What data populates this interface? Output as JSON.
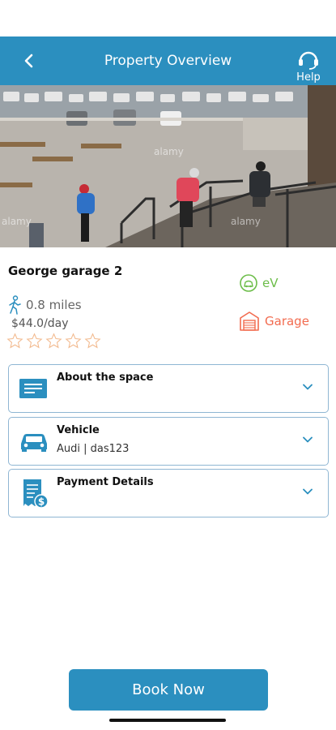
{
  "header": {
    "title": "Property Overview",
    "help_label": "Help",
    "back_icon": "arrow-back-icon",
    "help_icon": "headset-icon"
  },
  "hero": {
    "watermark": "alamy"
  },
  "property": {
    "name": "George garage 2",
    "distance": "0.8 miles",
    "price": "$44.0/day",
    "rating": 0,
    "rating_max": 5
  },
  "tags": {
    "ev_label": "eV",
    "garage_label": "Garage",
    "ev_color": "#6cbd49",
    "garage_color": "#f26b4f"
  },
  "cards": {
    "about": {
      "title": "About the space",
      "icon": "document-icon"
    },
    "vehicle": {
      "title": "Vehicle",
      "subtitle": "Audi | das123",
      "icon": "car-icon"
    },
    "payment": {
      "title": "Payment Details",
      "icon": "receipt-icon"
    }
  },
  "actions": {
    "book_now": "Book Now"
  },
  "colors": {
    "primary": "#2b8fbf",
    "card_border": "#8fb6d3"
  }
}
